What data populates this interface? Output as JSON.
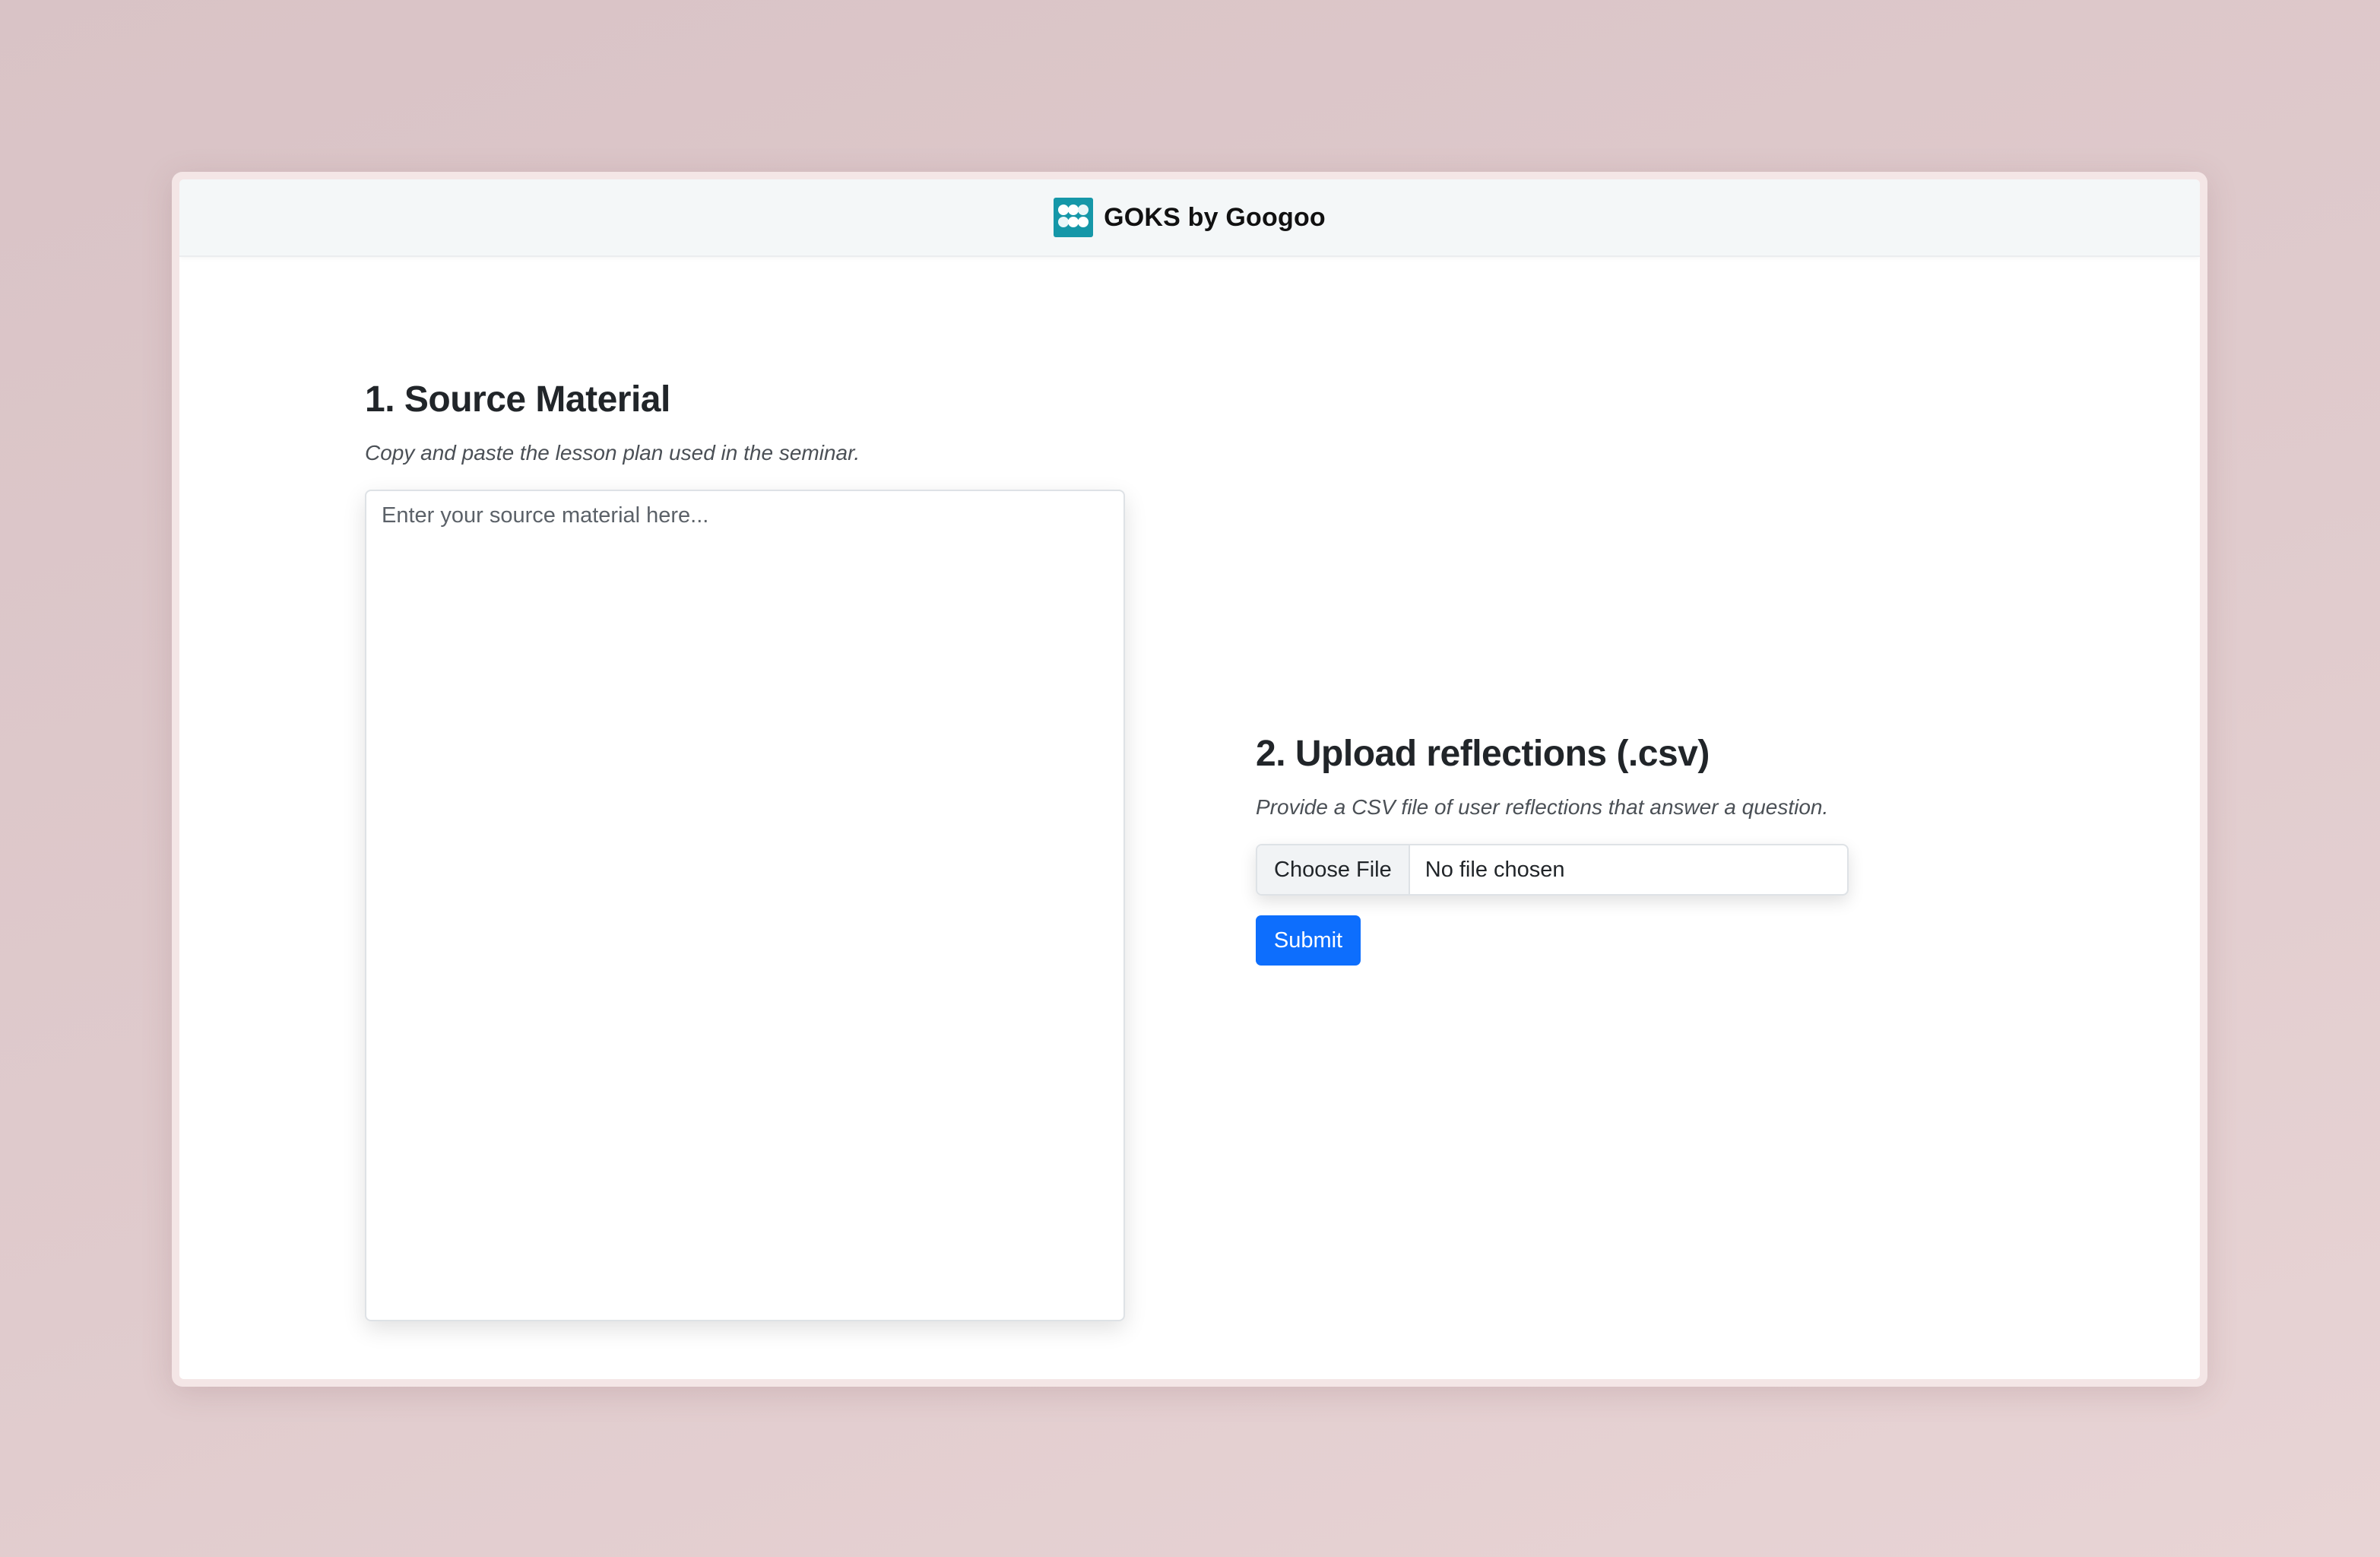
{
  "app": {
    "brand": "GOKS by Googoo",
    "logo_icon": "goks-logo-icon",
    "logo_color": "#1597a8"
  },
  "source_section": {
    "title": "1. Source Material",
    "description": "Copy and paste the lesson plan used in the seminar.",
    "textarea_placeholder": "Enter your source material here...",
    "textarea_value": ""
  },
  "upload_section": {
    "title": "2. Upload reflections (.csv)",
    "description": "Provide a CSV file of user reflections that answer a question.",
    "choose_file_label": "Choose File",
    "file_status": "No file chosen",
    "submit_label": "Submit",
    "submit_color": "#0d6efd"
  }
}
